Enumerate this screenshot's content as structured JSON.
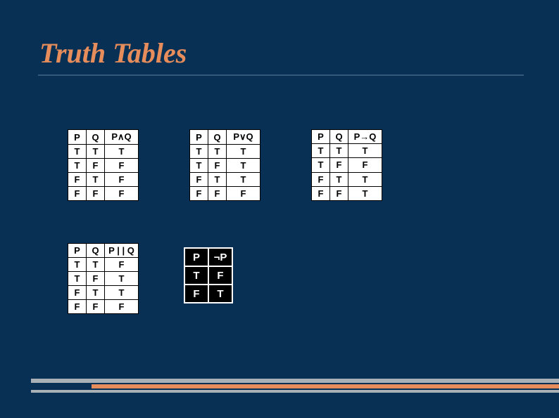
{
  "title": "Truth Tables",
  "headers": {
    "P": "P",
    "Q": "Q",
    "and": "P∧Q",
    "or": "P∨Q",
    "imp": "P→Q",
    "xor": "P | | Q",
    "notP": "¬P"
  },
  "and": {
    "rows": [
      {
        "P": "T",
        "Q": "T",
        "R": "T"
      },
      {
        "P": "T",
        "Q": "F",
        "R": "F"
      },
      {
        "P": "F",
        "Q": "T",
        "R": "F"
      },
      {
        "P": "F",
        "Q": "F",
        "R": "F"
      }
    ]
  },
  "or": {
    "rows": [
      {
        "P": "T",
        "Q": "T",
        "R": "T"
      },
      {
        "P": "T",
        "Q": "F",
        "R": "T"
      },
      {
        "P": "F",
        "Q": "T",
        "R": "T"
      },
      {
        "P": "F",
        "Q": "F",
        "R": "F"
      }
    ]
  },
  "imp": {
    "rows": [
      {
        "P": "T",
        "Q": "T",
        "R": "T"
      },
      {
        "P": "T",
        "Q": "F",
        "R": "F"
      },
      {
        "P": "F",
        "Q": "T",
        "R": "T"
      },
      {
        "P": "F",
        "Q": "F",
        "R": "T"
      }
    ]
  },
  "xor": {
    "rows": [
      {
        "P": "T",
        "Q": "T",
        "R": "F"
      },
      {
        "P": "T",
        "Q": "F",
        "R": "T"
      },
      {
        "P": "F",
        "Q": "T",
        "R": "T"
      },
      {
        "P": "F",
        "Q": "F",
        "R": "F"
      }
    ]
  },
  "neg": {
    "rows": [
      {
        "P": "T",
        "R": "F"
      },
      {
        "P": "F",
        "R": "T"
      }
    ]
  }
}
